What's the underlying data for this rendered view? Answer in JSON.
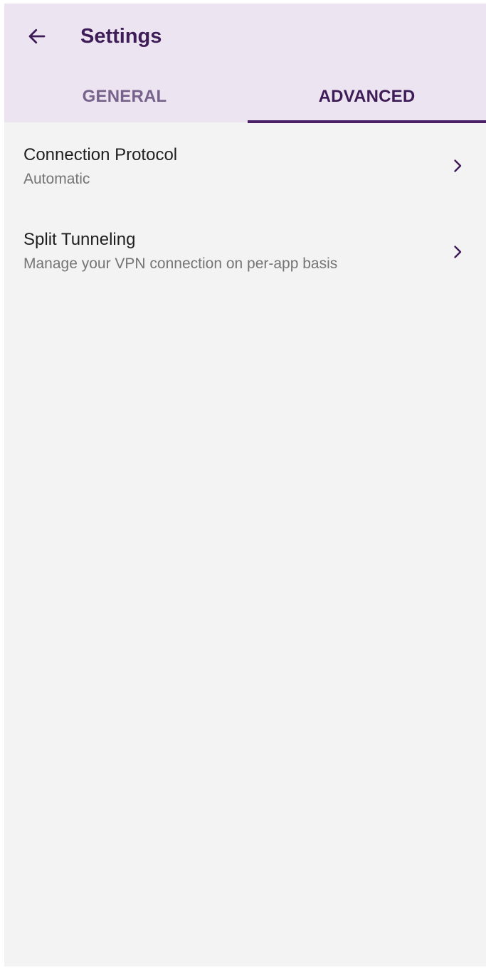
{
  "header": {
    "title": "Settings",
    "back_icon": "arrow-left-icon"
  },
  "tabs": [
    {
      "label": "GENERAL",
      "selected": false
    },
    {
      "label": "ADVANCED",
      "selected": true
    }
  ],
  "settings": [
    {
      "title": "Connection Protocol",
      "subtitle": "Automatic",
      "icon": "chevron-right-icon"
    },
    {
      "title": "Split Tunneling",
      "subtitle": "Manage your VPN connection on per-app basis",
      "icon": "chevron-right-icon"
    }
  ],
  "colors": {
    "header_bg": "#ece4f1",
    "primary": "#3e1c57",
    "inactive_tab": "#76628a",
    "page_bg": "#f4f3f4"
  }
}
